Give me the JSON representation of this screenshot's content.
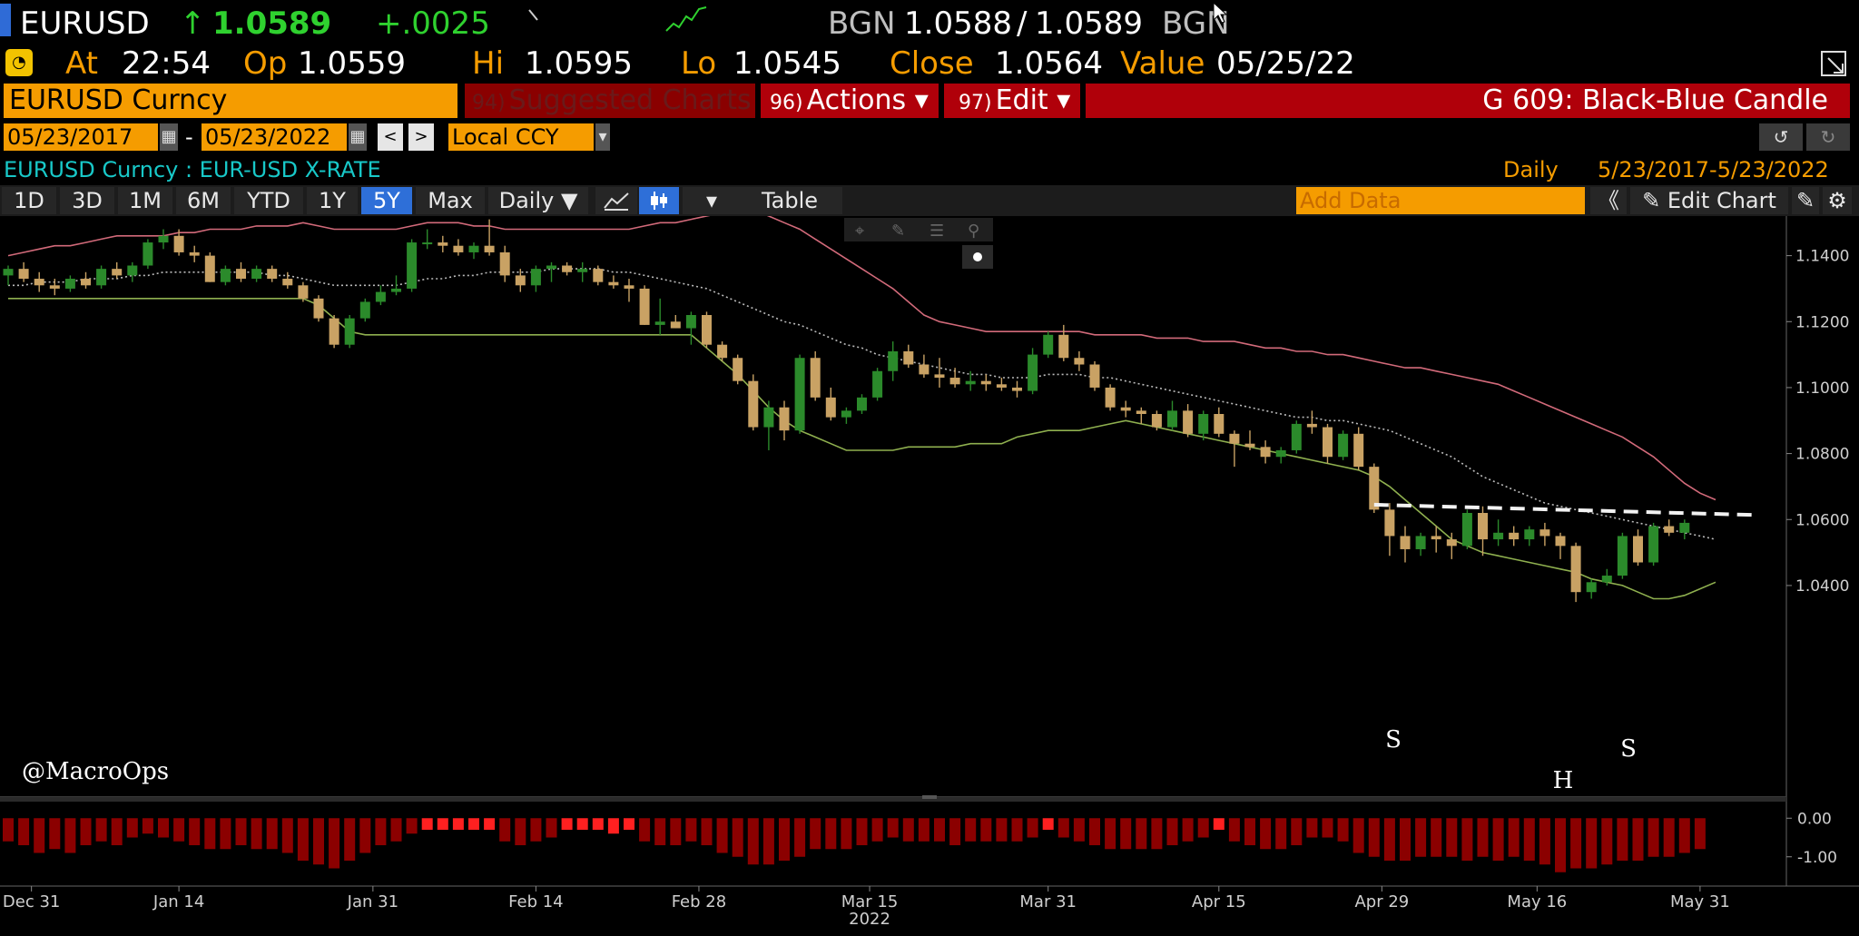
{
  "header": {
    "ticker": "EURUSD",
    "arrow": "↑",
    "last": "1.0589",
    "change": "+.0025",
    "source": "BGN",
    "bid": "1.0588",
    "slash": "/",
    "ask": "1.0589",
    "source2": "BGN"
  },
  "quote": {
    "at_label": "At",
    "time": "22:54",
    "op_label": "Op",
    "op": "1.0559",
    "hi_label": "Hi",
    "hi": "1.0595",
    "lo_label": "Lo",
    "lo": "1.0545",
    "close_label": "Close",
    "close": "1.0564",
    "value_label": "Value",
    "value": "05/25/22"
  },
  "menu": {
    "security": "EURUSD Curncy",
    "suggested_num": "94)",
    "suggested": "Suggested Charts",
    "actions_num": "96)",
    "actions": "Actions ▾",
    "edit_num": "97)",
    "edit": "Edit ▾",
    "chart_title": "G 609: Black-Blue Candle"
  },
  "range": {
    "start": "05/23/2017",
    "dash": "-",
    "end": "05/23/2022",
    "currency": "Local CCY",
    "cal_icon": "▦",
    "prev": "<",
    "next": ">",
    "dropdown": "▾",
    "undo": "↺",
    "redo": "↻"
  },
  "subtitle": {
    "left": "EURUSD Curncy : EUR-USD X-RATE",
    "period": "Daily",
    "range": "5/23/2017-5/23/2022"
  },
  "toolbar": {
    "periods": [
      "1D",
      "3D",
      "1M",
      "6M",
      "YTD",
      "1Y",
      "5Y",
      "Max"
    ],
    "active": "5Y",
    "frequency": "Daily ▼",
    "table": "Table",
    "add_data": "Add Data",
    "collapse": "《",
    "edit_chart": "✎ Edit Chart",
    "caret": "▾"
  },
  "watermark": "@MacroOps",
  "annotations": {
    "s1": "S",
    "h": "H",
    "s2": "S"
  },
  "colors": {
    "up": "#2b8a2b",
    "down": "#c9a264",
    "upper_band": "#d26a7a",
    "lower_band": "#8fb04f",
    "mid_band": "#bbbbbb",
    "histogram": "#8b0000",
    "histogram_bright": "#ff2020",
    "accent_orange": "#f59c00",
    "accent_red": "#b0000a"
  },
  "chart_data": {
    "type": "candlestick",
    "ylim": [
      1.032,
      1.152
    ],
    "yticks": [
      1.04,
      1.06,
      1.08,
      1.1,
      1.12,
      1.14
    ],
    "ytick_labels": [
      "1.0400",
      "1.0600",
      "1.0800",
      "1.1000",
      "1.1200",
      "1.1400"
    ],
    "xtick_labels": [
      "Dec 31",
      "Jan 14",
      "Jan 31",
      "Feb 14",
      "Feb 28",
      "Mar 15",
      "Mar 31",
      "Apr 15",
      "Apr 29",
      "May 16",
      "May 31"
    ],
    "x_year_label": "2022",
    "candles": [
      [
        1.134,
        1.137,
        1.131,
        1.136
      ],
      [
        1.136,
        1.138,
        1.132,
        1.133
      ],
      [
        1.133,
        1.135,
        1.129,
        1.131
      ],
      [
        1.131,
        1.133,
        1.128,
        1.13
      ],
      [
        1.13,
        1.134,
        1.129,
        1.133
      ],
      [
        1.133,
        1.135,
        1.13,
        1.131
      ],
      [
        1.131,
        1.137,
        1.13,
        1.136
      ],
      [
        1.136,
        1.138,
        1.133,
        1.134
      ],
      [
        1.134,
        1.138,
        1.132,
        1.137
      ],
      [
        1.137,
        1.145,
        1.136,
        1.144
      ],
      [
        1.144,
        1.148,
        1.142,
        1.146
      ],
      [
        1.146,
        1.148,
        1.14,
        1.141
      ],
      [
        1.141,
        1.143,
        1.138,
        1.14
      ],
      [
        1.14,
        1.141,
        1.132,
        1.132
      ],
      [
        1.132,
        1.137,
        1.131,
        1.136
      ],
      [
        1.136,
        1.138,
        1.132,
        1.133
      ],
      [
        1.133,
        1.137,
        1.132,
        1.136
      ],
      [
        1.136,
        1.137,
        1.132,
        1.133
      ],
      [
        1.133,
        1.135,
        1.13,
        1.131
      ],
      [
        1.131,
        1.132,
        1.126,
        1.127
      ],
      [
        1.127,
        1.128,
        1.12,
        1.121
      ],
      [
        1.121,
        1.122,
        1.112,
        1.113
      ],
      [
        1.113,
        1.122,
        1.112,
        1.121
      ],
      [
        1.121,
        1.127,
        1.12,
        1.126
      ],
      [
        1.126,
        1.131,
        1.125,
        1.129
      ],
      [
        1.129,
        1.134,
        1.128,
        1.13
      ],
      [
        1.13,
        1.145,
        1.129,
        1.144
      ],
      [
        1.144,
        1.148,
        1.142,
        1.144
      ],
      [
        1.144,
        1.146,
        1.141,
        1.143
      ],
      [
        1.143,
        1.145,
        1.14,
        1.141
      ],
      [
        1.141,
        1.144,
        1.139,
        1.143
      ],
      [
        1.143,
        1.151,
        1.14,
        1.141
      ],
      [
        1.141,
        1.143,
        1.132,
        1.134
      ],
      [
        1.134,
        1.136,
        1.129,
        1.131
      ],
      [
        1.131,
        1.137,
        1.129,
        1.136
      ],
      [
        1.136,
        1.138,
        1.132,
        1.137
      ],
      [
        1.137,
        1.138,
        1.134,
        1.135
      ],
      [
        1.135,
        1.138,
        1.132,
        1.136
      ],
      [
        1.136,
        1.137,
        1.131,
        1.132
      ],
      [
        1.132,
        1.134,
        1.13,
        1.131
      ],
      [
        1.131,
        1.133,
        1.126,
        1.13
      ],
      [
        1.13,
        1.131,
        1.119,
        1.119
      ],
      [
        1.119,
        1.127,
        1.116,
        1.12
      ],
      [
        1.12,
        1.122,
        1.118,
        1.118
      ],
      [
        1.118,
        1.123,
        1.113,
        1.122
      ],
      [
        1.122,
        1.123,
        1.112,
        1.113
      ],
      [
        1.113,
        1.114,
        1.108,
        1.109
      ],
      [
        1.109,
        1.11,
        1.101,
        1.102
      ],
      [
        1.102,
        1.104,
        1.087,
        1.088
      ],
      [
        1.088,
        1.096,
        1.081,
        1.094
      ],
      [
        1.094,
        1.096,
        1.084,
        1.087
      ],
      [
        1.087,
        1.11,
        1.086,
        1.109
      ],
      [
        1.109,
        1.111,
        1.096,
        1.097
      ],
      [
        1.097,
        1.1,
        1.09,
        1.091
      ],
      [
        1.091,
        1.094,
        1.089,
        1.093
      ],
      [
        1.093,
        1.098,
        1.092,
        1.097
      ],
      [
        1.097,
        1.106,
        1.096,
        1.105
      ],
      [
        1.105,
        1.114,
        1.102,
        1.111
      ],
      [
        1.111,
        1.113,
        1.106,
        1.107
      ],
      [
        1.107,
        1.11,
        1.103,
        1.104
      ],
      [
        1.104,
        1.109,
        1.1,
        1.103
      ],
      [
        1.103,
        1.106,
        1.1,
        1.101
      ],
      [
        1.101,
        1.105,
        1.099,
        1.102
      ],
      [
        1.102,
        1.104,
        1.099,
        1.101
      ],
      [
        1.101,
        1.103,
        1.099,
        1.1
      ],
      [
        1.1,
        1.102,
        1.097,
        1.099
      ],
      [
        1.099,
        1.112,
        1.098,
        1.11
      ],
      [
        1.11,
        1.117,
        1.109,
        1.116
      ],
      [
        1.116,
        1.119,
        1.108,
        1.109
      ],
      [
        1.109,
        1.111,
        1.105,
        1.107
      ],
      [
        1.107,
        1.108,
        1.099,
        1.1
      ],
      [
        1.1,
        1.101,
        1.093,
        1.094
      ],
      [
        1.094,
        1.096,
        1.091,
        1.093
      ],
      [
        1.093,
        1.094,
        1.089,
        1.092
      ],
      [
        1.092,
        1.093,
        1.087,
        1.088
      ],
      [
        1.088,
        1.096,
        1.087,
        1.093
      ],
      [
        1.093,
        1.095,
        1.085,
        1.086
      ],
      [
        1.086,
        1.093,
        1.084,
        1.092
      ],
      [
        1.092,
        1.094,
        1.085,
        1.086
      ],
      [
        1.086,
        1.087,
        1.076,
        1.083
      ],
      [
        1.083,
        1.087,
        1.081,
        1.082
      ],
      [
        1.082,
        1.084,
        1.077,
        1.079
      ],
      [
        1.079,
        1.082,
        1.077,
        1.081
      ],
      [
        1.081,
        1.09,
        1.08,
        1.089
      ],
      [
        1.089,
        1.093,
        1.086,
        1.088
      ],
      [
        1.088,
        1.089,
        1.077,
        1.079
      ],
      [
        1.079,
        1.087,
        1.078,
        1.086
      ],
      [
        1.086,
        1.088,
        1.075,
        1.076
      ],
      [
        1.076,
        1.077,
        1.062,
        1.063
      ],
      [
        1.063,
        1.065,
        1.049,
        1.055
      ],
      [
        1.055,
        1.058,
        1.047,
        1.051
      ],
      [
        1.051,
        1.056,
        1.049,
        1.055
      ],
      [
        1.055,
        1.058,
        1.05,
        1.054
      ],
      [
        1.054,
        1.056,
        1.048,
        1.052
      ],
      [
        1.052,
        1.063,
        1.051,
        1.062
      ],
      [
        1.062,
        1.064,
        1.049,
        1.054
      ],
      [
        1.054,
        1.06,
        1.052,
        1.056
      ],
      [
        1.056,
        1.058,
        1.052,
        1.054
      ],
      [
        1.054,
        1.058,
        1.052,
        1.057
      ],
      [
        1.057,
        1.059,
        1.052,
        1.055
      ],
      [
        1.055,
        1.056,
        1.048,
        1.052
      ],
      [
        1.052,
        1.053,
        1.035,
        1.038
      ],
      [
        1.038,
        1.042,
        1.036,
        1.041
      ],
      [
        1.041,
        1.045,
        1.04,
        1.043
      ],
      [
        1.043,
        1.056,
        1.042,
        1.055
      ],
      [
        1.055,
        1.057,
        1.046,
        1.047
      ],
      [
        1.047,
        1.059,
        1.046,
        1.058
      ],
      [
        1.058,
        1.06,
        1.055,
        1.056
      ],
      [
        1.056,
        1.06,
        1.054,
        1.059
      ]
    ],
    "upper_band": [
      1.14,
      1.141,
      1.142,
      1.143,
      1.143,
      1.144,
      1.145,
      1.146,
      1.146,
      1.146,
      1.146,
      1.147,
      1.147,
      1.148,
      1.148,
      1.148,
      1.149,
      1.149,
      1.149,
      1.15,
      1.149,
      1.148,
      1.148,
      1.148,
      1.148,
      1.148,
      1.149,
      1.15,
      1.15,
      1.15,
      1.149,
      1.149,
      1.148,
      1.148,
      1.148,
      1.148,
      1.148,
      1.148,
      1.148,
      1.148,
      1.148,
      1.149,
      1.15,
      1.15,
      1.151,
      1.152,
      1.153,
      1.154,
      1.154,
      1.152,
      1.15,
      1.148,
      1.145,
      1.142,
      1.139,
      1.136,
      1.133,
      1.13,
      1.126,
      1.122,
      1.12,
      1.119,
      1.118,
      1.117,
      1.117,
      1.117,
      1.117,
      1.117,
      1.117,
      1.117,
      1.116,
      1.116,
      1.116,
      1.116,
      1.115,
      1.115,
      1.115,
      1.114,
      1.114,
      1.114,
      1.113,
      1.112,
      1.112,
      1.111,
      1.111,
      1.11,
      1.11,
      1.109,
      1.108,
      1.107,
      1.106,
      1.106,
      1.105,
      1.104,
      1.103,
      1.102,
      1.101,
      1.099,
      1.097,
      1.095,
      1.093,
      1.091,
      1.089,
      1.087,
      1.085,
      1.082,
      1.079,
      1.075,
      1.071,
      1.068,
      1.066
    ],
    "mid_band": [
      1.131,
      1.131,
      1.132,
      1.132,
      1.132,
      1.133,
      1.133,
      1.133,
      1.134,
      1.134,
      1.135,
      1.135,
      1.135,
      1.135,
      1.135,
      1.135,
      1.135,
      1.134,
      1.134,
      1.133,
      1.132,
      1.131,
      1.131,
      1.131,
      1.131,
      1.131,
      1.132,
      1.133,
      1.133,
      1.134,
      1.134,
      1.135,
      1.135,
      1.135,
      1.135,
      1.136,
      1.136,
      1.136,
      1.136,
      1.135,
      1.135,
      1.134,
      1.133,
      1.132,
      1.131,
      1.13,
      1.128,
      1.126,
      1.124,
      1.122,
      1.12,
      1.119,
      1.117,
      1.115,
      1.113,
      1.112,
      1.11,
      1.109,
      1.108,
      1.107,
      1.106,
      1.105,
      1.104,
      1.104,
      1.103,
      1.103,
      1.103,
      1.104,
      1.104,
      1.104,
      1.103,
      1.103,
      1.102,
      1.101,
      1.1,
      1.099,
      1.098,
      1.097,
      1.096,
      1.095,
      1.094,
      1.093,
      1.092,
      1.091,
      1.091,
      1.09,
      1.09,
      1.089,
      1.088,
      1.087,
      1.085,
      1.083,
      1.081,
      1.079,
      1.076,
      1.073,
      1.071,
      1.069,
      1.067,
      1.065,
      1.064,
      1.063,
      1.062,
      1.061,
      1.06,
      1.059,
      1.058,
      1.057,
      1.056,
      1.055,
      1.054
    ],
    "lower_band": [
      1.127,
      1.127,
      1.127,
      1.127,
      1.127,
      1.127,
      1.127,
      1.127,
      1.127,
      1.127,
      1.127,
      1.127,
      1.127,
      1.127,
      1.127,
      1.127,
      1.127,
      1.127,
      1.127,
      1.127,
      1.125,
      1.121,
      1.117,
      1.116,
      1.116,
      1.116,
      1.116,
      1.116,
      1.116,
      1.116,
      1.116,
      1.116,
      1.116,
      1.116,
      1.116,
      1.116,
      1.116,
      1.116,
      1.116,
      1.116,
      1.116,
      1.116,
      1.116,
      1.116,
      1.116,
      1.112,
      1.108,
      1.104,
      1.099,
      1.094,
      1.09,
      1.087,
      1.085,
      1.083,
      1.081,
      1.081,
      1.081,
      1.081,
      1.082,
      1.082,
      1.082,
      1.082,
      1.083,
      1.083,
      1.083,
      1.085,
      1.086,
      1.087,
      1.087,
      1.087,
      1.088,
      1.089,
      1.09,
      1.089,
      1.088,
      1.087,
      1.086,
      1.085,
      1.084,
      1.083,
      1.082,
      1.081,
      1.08,
      1.079,
      1.078,
      1.077,
      1.076,
      1.075,
      1.073,
      1.07,
      1.066,
      1.062,
      1.058,
      1.054,
      1.052,
      1.05,
      1.049,
      1.048,
      1.047,
      1.046,
      1.045,
      1.044,
      1.042,
      1.041,
      1.04,
      1.038,
      1.036,
      1.036,
      1.037,
      1.039,
      1.041
    ],
    "resistance_line": [
      1.0645,
      1.0614
    ],
    "histogram": [
      -0.6,
      -0.7,
      -0.9,
      -0.8,
      -0.9,
      -0.7,
      -0.6,
      -0.7,
      -0.5,
      -0.4,
      -0.5,
      -0.6,
      -0.7,
      -0.8,
      -0.8,
      -0.7,
      -0.8,
      -0.8,
      -0.9,
      -1.1,
      -1.2,
      -1.3,
      -1.1,
      -0.9,
      -0.7,
      -0.6,
      -0.4,
      -0.3,
      -0.3,
      -0.3,
      -0.3,
      -0.3,
      -0.6,
      -0.7,
      -0.6,
      -0.5,
      -0.3,
      -0.3,
      -0.3,
      -0.4,
      -0.3,
      -0.6,
      -0.7,
      -0.7,
      -0.6,
      -0.7,
      -0.9,
      -1.0,
      -1.2,
      -1.2,
      -1.1,
      -1.0,
      -0.8,
      -0.8,
      -0.8,
      -0.7,
      -0.6,
      -0.5,
      -0.6,
      -0.6,
      -0.6,
      -0.7,
      -0.6,
      -0.6,
      -0.6,
      -0.6,
      -0.5,
      -0.3,
      -0.5,
      -0.6,
      -0.7,
      -0.8,
      -0.8,
      -0.8,
      -0.8,
      -0.7,
      -0.6,
      -0.5,
      -0.3,
      -0.6,
      -0.7,
      -0.8,
      -0.8,
      -0.7,
      -0.5,
      -0.5,
      -0.6,
      -0.9,
      -1.0,
      -1.1,
      -1.1,
      -1.0,
      -1.0,
      -1.0,
      -1.1,
      -1.0,
      -1.1,
      -1.0,
      -1.1,
      -1.2,
      -1.4,
      -1.3,
      -1.3,
      -1.2,
      -1.1,
      -1.1,
      -1.0,
      -1.0,
      -0.9,
      -0.8
    ],
    "histogram_bright_index": [
      27,
      28,
      29,
      30,
      31,
      36,
      37,
      38,
      39,
      40,
      67,
      78
    ],
    "histogram_ylim": [
      -1.5,
      0.1
    ],
    "histogram_ticks": [
      "0.00",
      "-1.00"
    ],
    "xtick_index": [
      1.5,
      11,
      23.5,
      34,
      44.5,
      55.5,
      67,
      78,
      88.5,
      98.5,
      109
    ]
  }
}
